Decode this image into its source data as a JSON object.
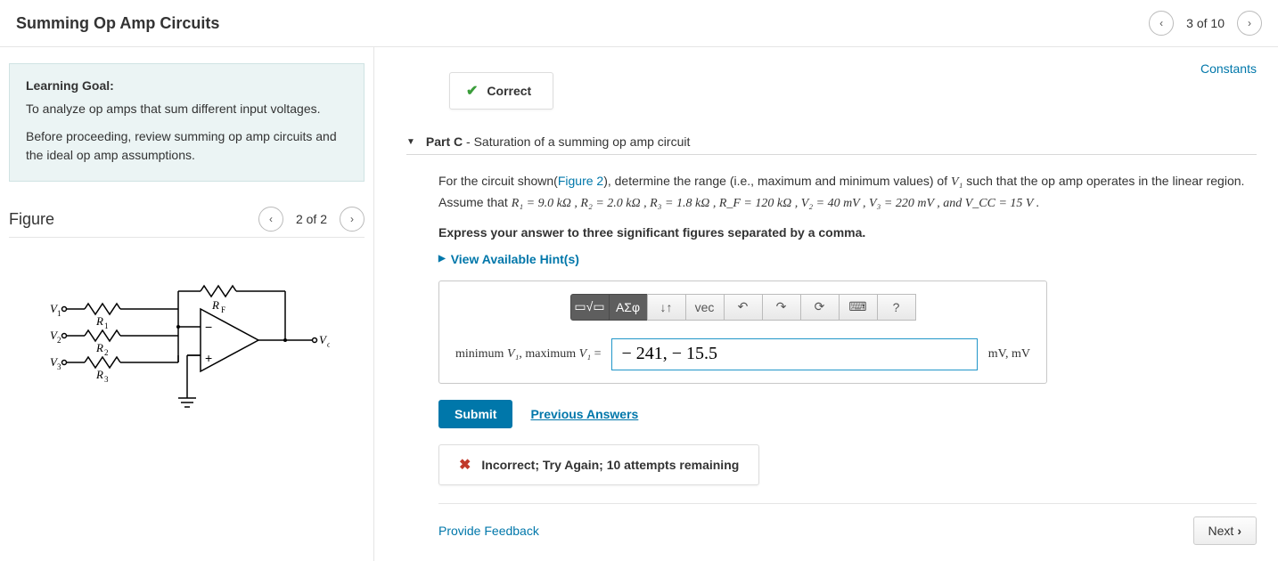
{
  "header": {
    "title": "Summing Op Amp Circuits",
    "page_label": "3 of 10"
  },
  "left": {
    "goal_title": "Learning Goal:",
    "goal_p1": "To analyze op amps that sum different input voltages.",
    "goal_p2": "Before proceeding, review summing op amp circuits and the ideal op amp assumptions.",
    "figure_title": "Figure",
    "figure_page": "2 of 2"
  },
  "right": {
    "constants": "Constants",
    "correct": "Correct",
    "part_label": "Part C",
    "part_title": " - Saturation of a summing op amp circuit",
    "q_pre": "For the circuit shown(",
    "q_figref": "Figure 2",
    "q_mid1": "), determine the range (i.e., maximum and minimum values) of ",
    "q_v1": "V₁",
    "q_mid2": " such that the op amp operates in the linear region. Assume that ",
    "q_params": "R₁ = 9.0 kΩ , R₂ = 2.0 kΩ , R₃ = 1.8 kΩ , R_F = 120 kΩ , V₂ = 40 mV , V₃ = 220 mV , and V_CC = 15 V .",
    "express": "Express your answer to three significant figures separated by a comma.",
    "hints": "View Available Hint(s)",
    "answer_label_pre": "minimum ",
    "answer_label_v": "V₁",
    "answer_label_mid": ", maximum ",
    "answer_label_eq": " = ",
    "answer_value": "− 241, − 15.5",
    "units": "mV, mV",
    "toolbar": {
      "templates": "▭√▭",
      "greek": "ΑΣφ",
      "subsup": "↓↑",
      "vec": "vec",
      "undo": "↶",
      "redo": "↷",
      "reset": "⟳",
      "keyboard": "⌨",
      "help": "?"
    },
    "submit": "Submit",
    "previous": "Previous Answers",
    "incorrect": "Incorrect; Try Again; 10 attempts remaining",
    "feedback": "Provide Feedback",
    "next": "Next"
  }
}
